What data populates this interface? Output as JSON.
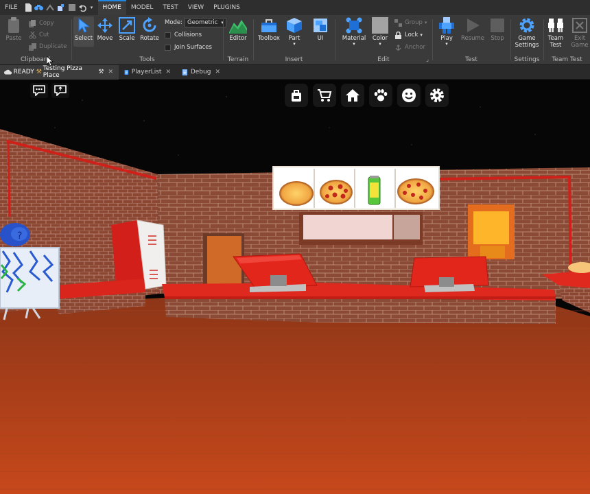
{
  "menubar": {
    "file": "FILE",
    "tabs": [
      "HOME",
      "MODEL",
      "TEST",
      "VIEW",
      "PLUGINS"
    ]
  },
  "ribbon": {
    "clipboard": {
      "paste": "Paste",
      "copy": "Copy",
      "cut": "Cut",
      "duplicate": "Duplicate",
      "label": "Clipboard"
    },
    "tools": {
      "select": "Select",
      "move": "Move",
      "scale": "Scale",
      "rotate": "Rotate",
      "mode_label": "Mode:",
      "mode_value": "Geometric",
      "collisions": "Collisions",
      "join_surfaces": "Join Surfaces",
      "label": "Tools"
    },
    "terrain": {
      "editor": "Editor",
      "label": "Terrain"
    },
    "insert": {
      "toolbox": "Toolbox",
      "part": "Part",
      "ui": "UI",
      "label": "Insert"
    },
    "edit": {
      "material": "Material",
      "color": "Color",
      "group": "Group",
      "lock": "Lock",
      "anchor": "Anchor",
      "label": "Edit"
    },
    "test": {
      "play": "Play",
      "resume": "Resume",
      "stop": "Stop",
      "label": "Test"
    },
    "settings": {
      "game_settings_line1": "Game",
      "game_settings_line2": "Settings",
      "label": "Settings"
    },
    "team_test": {
      "team_test_line1": "Team",
      "team_test_line2": "Test",
      "exit_line1": "Exit",
      "exit_line2": "Game",
      "label": "Team Test"
    }
  },
  "tabs": {
    "status": "READY",
    "place": "Testing Pizza Place",
    "playerlist": "PlayerList",
    "debug": "Debug"
  },
  "hud": {
    "icons": [
      "backpack-icon",
      "cart-icon",
      "home-icon",
      "paw-icon",
      "smile-icon",
      "gear-icon"
    ]
  },
  "colors": {
    "accent": "#1e88e5",
    "ribbon_bg": "#3a3a3a",
    "brick": "#8a4a35",
    "counter_red": "#d9251c",
    "floor": "#b2401a"
  }
}
